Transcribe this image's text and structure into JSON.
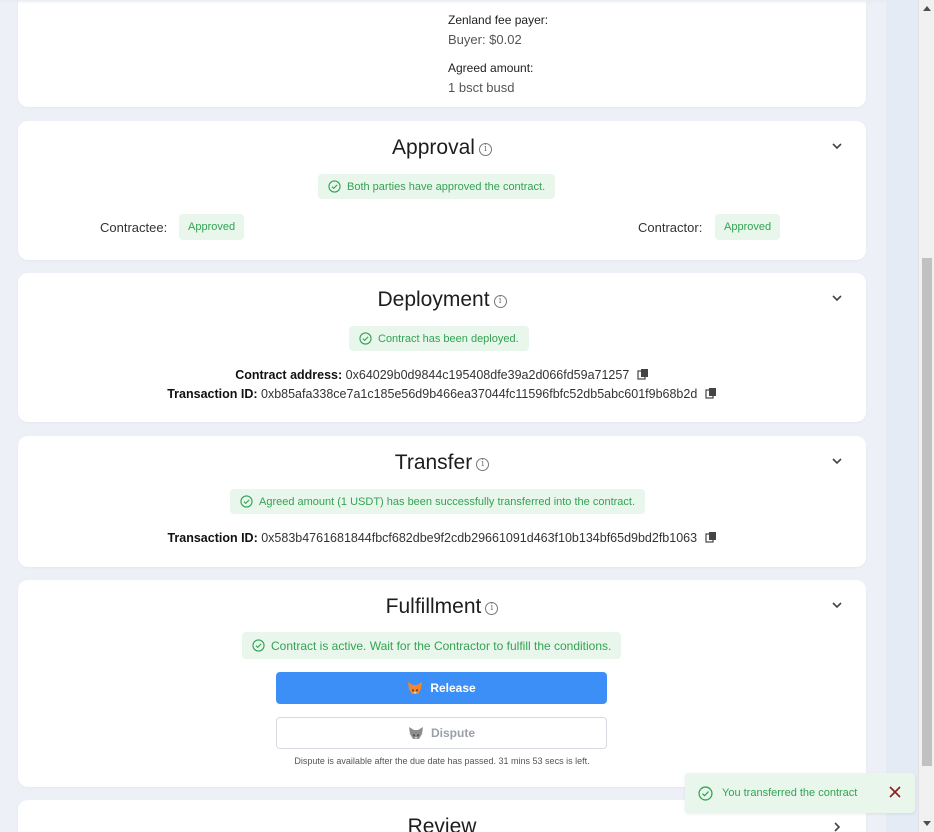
{
  "fees": {
    "fee_payer_label": "Zenland fee payer:",
    "fee_payer_value": "Buyer: $0.02",
    "agreed_amount_label": "Agreed amount:",
    "agreed_amount_value": "1 bsct busd"
  },
  "approval": {
    "title": "Approval",
    "status": "Both parties have approved the contract.",
    "contractee_label": "Contractee:",
    "contractee_status": "Approved",
    "contractor_label": "Contractor:",
    "contractor_status": "Approved"
  },
  "deployment": {
    "title": "Deployment",
    "status": "Contract has been deployed.",
    "contract_address_label": "Contract address:",
    "contract_address": "0x64029b0d9844c195408dfe39a2d066fd59a71257",
    "tx_label": "Transaction ID:",
    "tx_id": "0xb85afa338ce7a1c185e56d9b466ea37044fc11596fbfc52db5abc601f9b68b2d"
  },
  "transfer": {
    "title": "Transfer",
    "status": "Agreed amount (1 USDT) has been successfully transferred into the contract.",
    "tx_label": "Transaction ID:",
    "tx_id": "0x583b4761681844fbcf682dbe9f2cdb29661091d463f10b134bf65d9bd2fb1063"
  },
  "fulfillment": {
    "title": "Fulfillment",
    "status": "Contract is active. Wait for the Contractor to fulfill the conditions.",
    "release_label": "Release",
    "dispute_label": "Dispute",
    "dispute_note": "Dispute is available after the due date has passed. 31 mins 53 secs is left."
  },
  "review": {
    "title": "Review"
  },
  "toast": {
    "message": "You transferred the contract"
  },
  "colors": {
    "success_bg": "#e8f6ec",
    "success_text": "#33a353",
    "primary": "#3b8ff6",
    "page_bg": "#edf1f7"
  },
  "icons": {
    "info": "info-circle-icon",
    "chevron": "chevron-down-icon",
    "check": "check-circle-icon",
    "copy": "copy-icon",
    "wallet": "metamask-fox-icon",
    "close": "close-icon"
  }
}
